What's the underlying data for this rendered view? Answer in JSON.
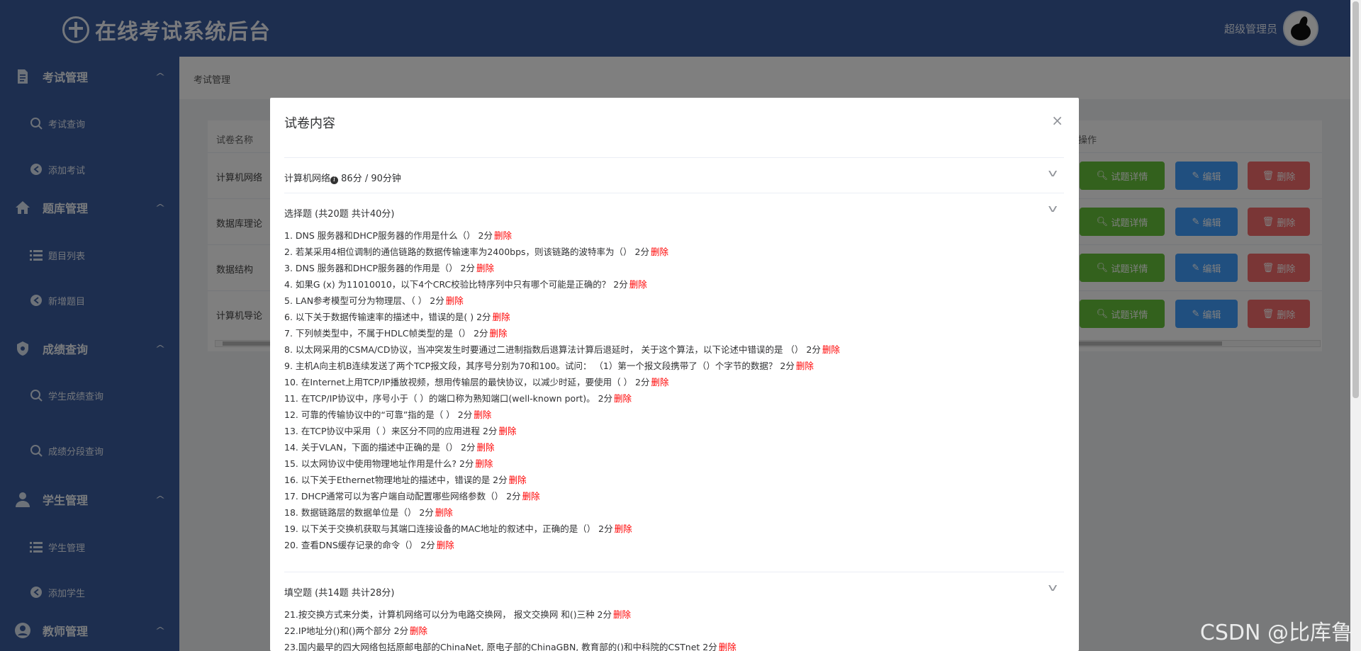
{
  "header": {
    "title": "在线考试系统后台",
    "user": "超级管理员"
  },
  "sidebar": {
    "groups": [
      {
        "label": "考试管理",
        "icon": "document-icon",
        "items": [
          {
            "label": "考试查询"
          },
          {
            "label": "添加考试"
          }
        ]
      },
      {
        "label": "题库管理",
        "icon": "home-icon",
        "items": [
          {
            "label": "题目列表"
          },
          {
            "label": "新增题目"
          }
        ]
      },
      {
        "label": "成绩查询",
        "icon": "shield-icon",
        "items": [
          {
            "label": "学生成绩查询"
          },
          {
            "label": "成绩分段查询"
          }
        ]
      },
      {
        "label": "学生管理",
        "icon": "user-icon",
        "items": [
          {
            "label": "学生管理"
          },
          {
            "label": "添加学生"
          }
        ]
      },
      {
        "label": "教师管理",
        "icon": "teacher-icon",
        "items": []
      }
    ]
  },
  "breadcrumb": "考试管理",
  "table": {
    "headers": {
      "name": "试卷名称",
      "ops": "操作"
    },
    "rows": [
      {
        "name": "计算机网络"
      },
      {
        "name": "数据库理论"
      },
      {
        "name": "数据结构"
      },
      {
        "name": "计算机导论"
      }
    ],
    "buttons": {
      "detail": "试题详情",
      "edit": "编辑",
      "delete": "删除"
    }
  },
  "dialog": {
    "title": "试卷内容",
    "close": "×",
    "paper": {
      "name": "计算机网络",
      "info": "86分 / 90分钟"
    },
    "section1": {
      "title": "选择题 (共20题 共计40分)"
    },
    "section2": {
      "title": "填空题 (共14题 共计28分)"
    },
    "delete_label": "删除",
    "choice_questions": [
      "1. DNS 服务器和DHCP服务器的作用是什么（） 2分",
      "2. 若某采用4相位调制的通信链路的数据传输速率为2400bps，则该链路的波特率为（） 2分",
      "3. DNS 服务器和DHCP服务器的作用是（） 2分",
      "4. 如果G (x) 为11010010，以下4个CRC校验比特序列中只有哪个可能是正确的？ 2分",
      "5. LAN参考模型可分为物理层、（ ） 2分",
      "6. 以下关于数据传输速率的描述中，错误的是( ) 2分",
      "7. 下列帧类型中，不属于HDLC帧类型的是（） 2分",
      "8. 以太网采用的CSMA/CD协议，当冲突发生时要通过二进制指数后退算法计算后退延时， 关于这个算法，以下论述中错误的是 （） 2分",
      "9. 主机A向主机B连续发送了两个TCP报文段，其序号分别为70和100。试问： （1）第一个报文段携带了（）个字节的数据？ 2分",
      "10. 在Internet上用TCP/IP播放视频，想用传输层的最快协议，以减少时延，要使用（ ） 2分",
      "11. 在TCP/IP协议中，序号小于（ ）的端口称为熟知端口(well-known port)。 2分",
      "12. 可靠的传输协议中的“可靠”指的是（ ） 2分",
      "13. 在TCP协议中采用（ ）来区分不同的应用进程 2分",
      "14. 关于VLAN，下面的描述中正确的是（） 2分",
      "15. 以太网协议中使用物理地址作用是什么? 2分",
      "16. 以下关于Ethernet物理地址的描述中，错误的是 2分",
      "17. DHCP通常可以为客户端自动配置哪些网络参数（） 2分",
      "18. 数据链路层的数据单位是（） 2分",
      "19. 以下关于交换机获取与其端口连接设备的MAC地址的叙述中，正确的是（） 2分",
      "20. 查看DNS缓存记录的命令（） 2分"
    ],
    "fill_questions": [
      "21.按交换方式来分类，计算机网络可以分为电路交换网， 报文交换网 和()三种 2分",
      "22.IP地址分()和()两个部分 2分",
      "23.国内最早的四大网络包括原邮电部的ChinaNet, 原电子部的ChinaGBN, 教育部的()和中科院的CSTnet 2分"
    ]
  },
  "watermark": "CSDN @比库鲁",
  "colors": {
    "primary": "#3b5d9f",
    "success": "#67c23a",
    "info": "#409eff",
    "danger": "#f56c6c",
    "delete_link": "#ff0000"
  }
}
